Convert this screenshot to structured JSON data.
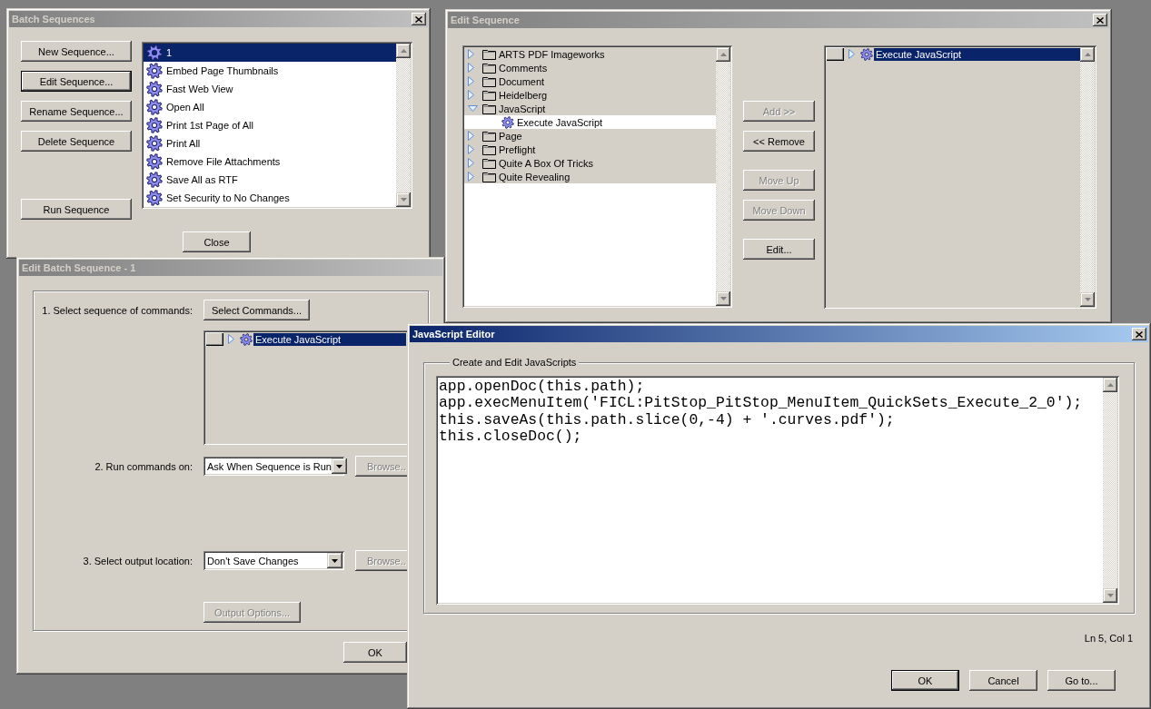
{
  "batch_sequences": {
    "title": "Batch Sequences",
    "active": false,
    "button_groups": [
      [
        {
          "label": "New Sequence...",
          "default": false
        },
        {
          "label": "Edit Sequence...",
          "default": true
        },
        {
          "label": "Rename Sequence...",
          "default": false
        },
        {
          "label": "Delete Sequence",
          "default": false
        }
      ],
      [
        {
          "label": "Run Sequence",
          "default": false
        }
      ]
    ],
    "sequences": [
      {
        "label": "1",
        "selected": true
      },
      {
        "label": "Embed Page Thumbnails",
        "selected": false
      },
      {
        "label": "Fast Web View",
        "selected": false
      },
      {
        "label": "Open All",
        "selected": false
      },
      {
        "label": "Print 1st Page of All",
        "selected": false
      },
      {
        "label": "Print All",
        "selected": false
      },
      {
        "label": "Remove File Attachments",
        "selected": false
      },
      {
        "label": "Save All as RTF",
        "selected": false
      },
      {
        "label": "Set Security to No Changes",
        "selected": false
      }
    ],
    "close_button": "Close"
  },
  "edit_batch_sequence": {
    "title": "Edit Batch Sequence - 1",
    "active": false,
    "commands_label": "1. Select sequence of commands:",
    "select_commands_button": {
      "label": "Select Commands...",
      "disabled": false
    },
    "commands": [
      {
        "label": "Execute JavaScript",
        "checked": false,
        "expanded": false,
        "selected": true
      }
    ],
    "run_on": {
      "label": "2. Run commands on:",
      "value": "Ask When Sequence is Run",
      "browse_button": {
        "label": "Browse..",
        "disabled": true
      }
    },
    "output_location": {
      "label": "3. Select output location:",
      "value": "Don't Save Changes",
      "browse_button": {
        "label": "Browse..",
        "disabled": true
      }
    },
    "output_options_button": {
      "label": "Output Options...",
      "disabled": true
    },
    "ok_button": "OK"
  },
  "edit_sequence": {
    "title": "Edit Sequence",
    "active": false,
    "commands": [
      {
        "kind": "category",
        "label": "ARTS PDF Imageworks",
        "expanded": false
      },
      {
        "kind": "category",
        "label": "Comments",
        "expanded": false
      },
      {
        "kind": "category",
        "label": "Document",
        "expanded": false
      },
      {
        "kind": "category",
        "label": "Heidelberg",
        "expanded": false
      },
      {
        "kind": "category",
        "label": "JavaScript",
        "expanded": true,
        "children": [
          {
            "kind": "command",
            "label": "Execute JavaScript"
          }
        ]
      },
      {
        "kind": "category",
        "label": "Page",
        "expanded": false
      },
      {
        "kind": "category",
        "label": "Preflight",
        "expanded": false
      },
      {
        "kind": "category",
        "label": "Quite A Box Of Tricks",
        "expanded": false
      },
      {
        "kind": "category",
        "label": "Quite Revealing",
        "expanded": false
      }
    ],
    "button_groups": [
      [
        {
          "label": "Add >>",
          "disabled": true
        },
        {
          "label": "<< Remove",
          "disabled": false
        }
      ],
      [
        {
          "label": "Move Up",
          "disabled": true
        },
        {
          "label": "Move Down",
          "disabled": true
        }
      ],
      [
        {
          "label": "Edit...",
          "disabled": false
        }
      ]
    ],
    "sequence": [
      {
        "label": "Execute JavaScript",
        "checked": false,
        "expanded": false,
        "selected": true
      }
    ]
  },
  "javascript_editor": {
    "title": "JavaScript Editor",
    "active": true,
    "group_label": "Create and Edit JavaScripts",
    "code": "app.openDoc(this.path);\napp.execMenuItem('FICL:PitStop_PitStop_MenuItem_QuickSets_Execute_2_0');\nthis.saveAs(this.path.slice(0,-4) + '.curves.pdf');\nthis.closeDoc();",
    "cursor_position": "Ln 5, Col 1",
    "buttons": [
      {
        "label": "OK",
        "default": true
      },
      {
        "label": "Cancel",
        "default": false
      },
      {
        "label": "Go to...",
        "default": false
      }
    ]
  }
}
